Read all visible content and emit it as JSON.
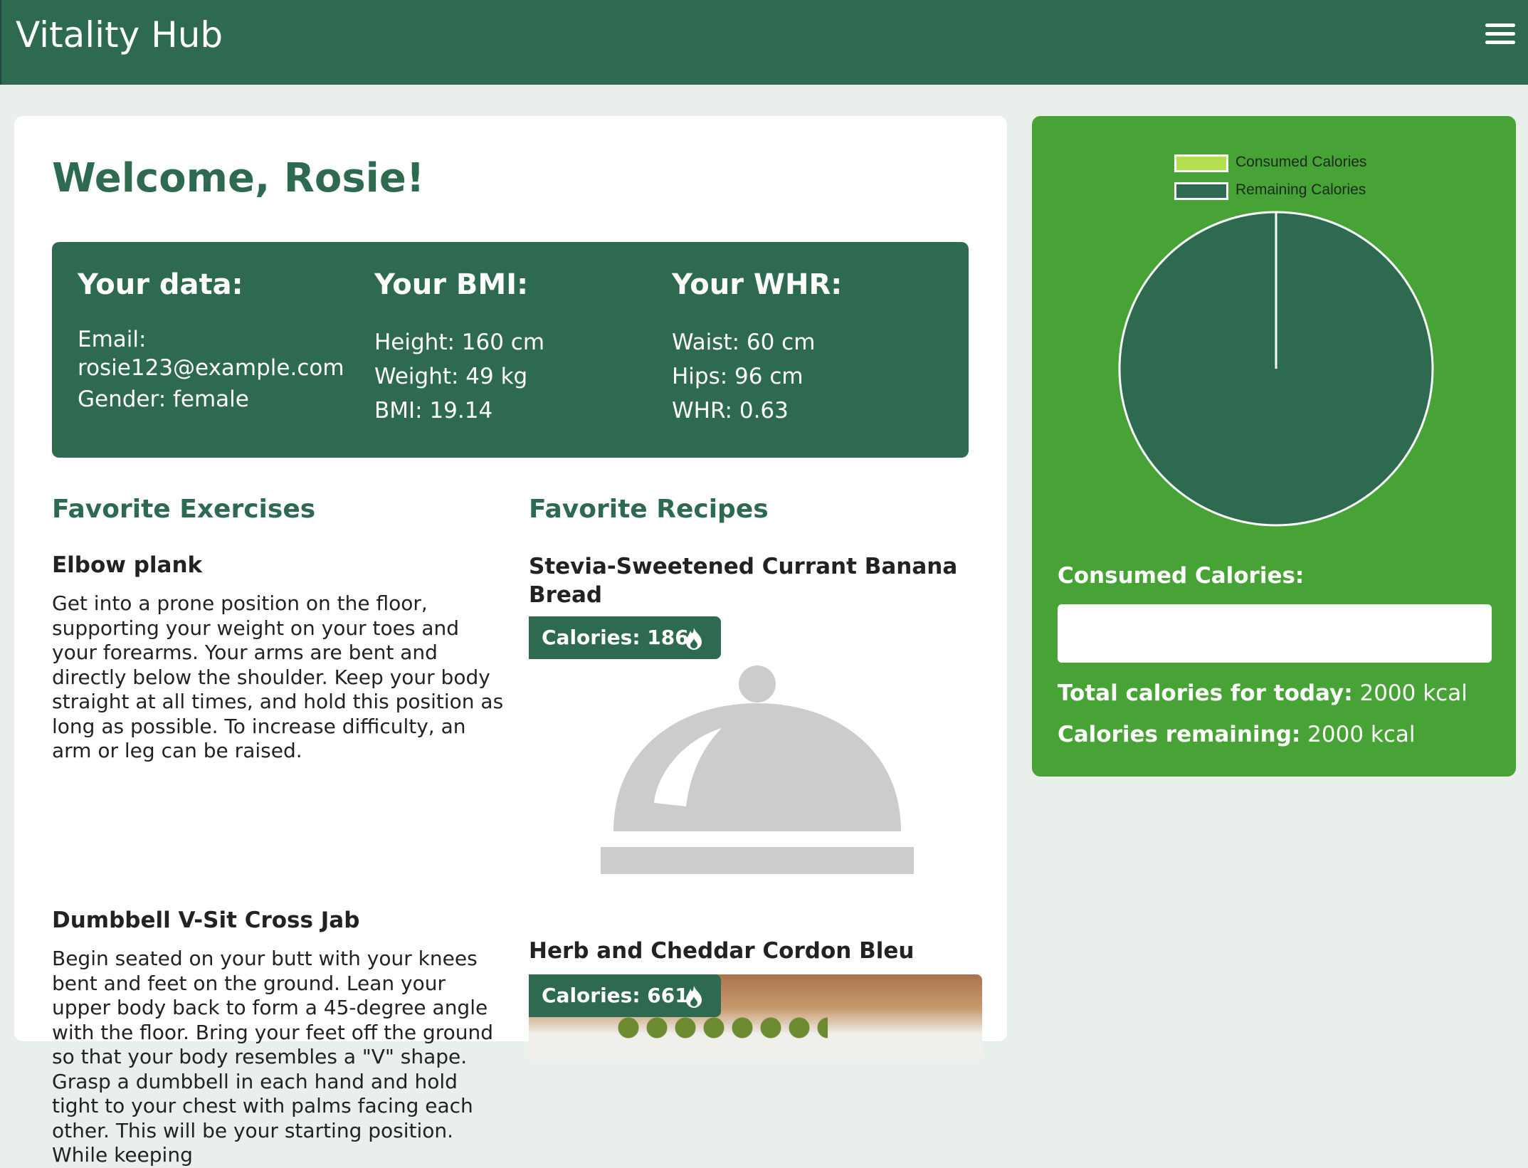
{
  "header": {
    "brand": "Vitality Hub",
    "menu_icon": "hamburger-menu-icon"
  },
  "welcome": "Welcome, Rosie!",
  "your_data": {
    "title": "Your data:",
    "email_label": "Email:",
    "email": "rosie123@example.com",
    "gender": "Gender: female"
  },
  "your_bmi": {
    "title": "Your BMI:",
    "height": "Height: 160 cm",
    "weight": "Weight: 49 kg",
    "bmi": "BMI: 19.14"
  },
  "your_whr": {
    "title": "Your WHR:",
    "waist": "Waist: 60 cm",
    "hips": "Hips: 96 cm",
    "whr": "WHR: 0.63"
  },
  "exercises": {
    "title": "Favorite Exercises",
    "items": [
      {
        "name": "Elbow plank",
        "description": "Get into a prone position on the floor, supporting your weight on your toes and your forearms. Your arms are bent and directly below the shoulder. Keep your body straight at all times, and hold this position as long as possible. To increase difficulty, an arm or leg can be raised."
      },
      {
        "name": "Dumbbell V-Sit Cross Jab",
        "description": "Begin seated on your butt with your knees bent and feet on the ground. Lean your upper body back to form a 45-degree angle with the floor. Bring your feet off the ground so that your body resembles a \"V\" shape. Grasp a dumbbell in each hand and hold tight to your chest with palms facing each other. This will be your starting position. While keeping"
      }
    ]
  },
  "recipes": {
    "title": "Favorite Recipes",
    "items": [
      {
        "name": "Stevia-Sweetened Currant Banana Bread",
        "calories": "Calories: 186",
        "image": "placeholder-dish-icon"
      },
      {
        "name": "Herb and Cheddar Cordon Bleu",
        "calories": "Calories: 661",
        "image": "food-photo"
      }
    ]
  },
  "calories": {
    "consumed_label": "Consumed Calories:",
    "consumed_input_value": "",
    "total_label": "Total calories for today:",
    "total_value": "2000 kcal",
    "remaining_label": "Calories remaining:",
    "remaining_value": "2000 kcal"
  },
  "chart_data": {
    "type": "pie",
    "categories": [
      "Consumed Calories",
      "Remaining Calories"
    ],
    "values": [
      0,
      2000
    ],
    "colors": [
      "#b4e04f",
      "#2e6a4f"
    ],
    "legend": "top"
  },
  "colors": {
    "primary": "#2e6a4f",
    "side_panel": "#48a336",
    "background": "#e9efea"
  }
}
